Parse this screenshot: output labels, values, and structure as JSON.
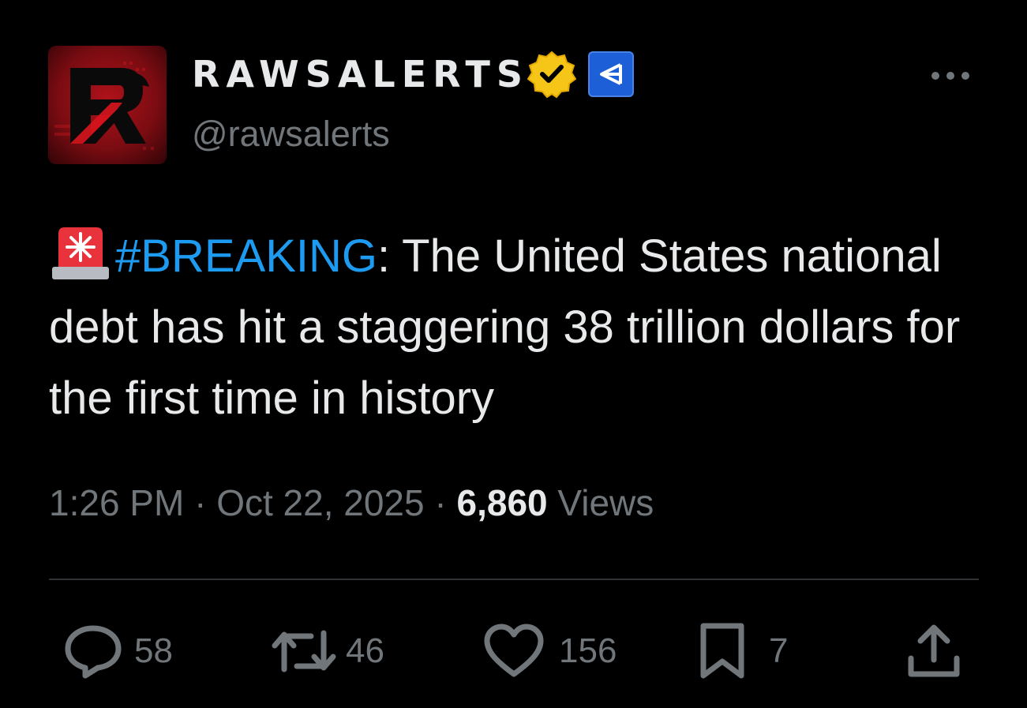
{
  "author": {
    "display_name": "RAWSALERTS",
    "handle": "@rawsalerts",
    "avatar_icon": "rawsalerts-logo",
    "verified_icon": "verified-gold-badge-icon",
    "affiliate_icon": "affiliate-badge-icon"
  },
  "tweet": {
    "emoji_icon": "police-siren-icon",
    "hashtag": "#BREAKING",
    "text_after_hashtag": ": The United States national debt has hit a staggering 38 trillion dollars for the first time in history"
  },
  "meta": {
    "time": "1:26 PM",
    "separator": " · ",
    "date": "Oct 22, 2025",
    "views_count": "6,860",
    "views_label": " Views"
  },
  "actions": {
    "replies": "58",
    "reposts": "46",
    "likes": "156",
    "bookmarks": "7"
  },
  "colors": {
    "background": "#000000",
    "text": "#e7e9ea",
    "secondary": "#71767b",
    "link": "#1d9bf0",
    "verified": "#f5c518",
    "affiliate": "#1d5fd6"
  }
}
